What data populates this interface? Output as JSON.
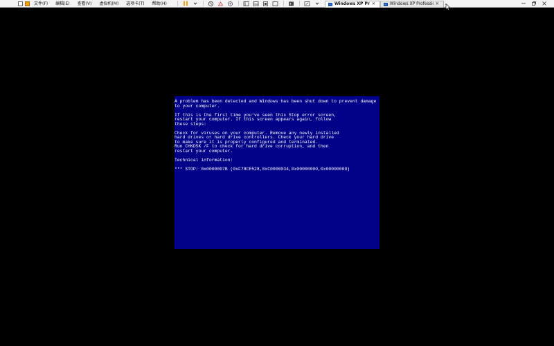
{
  "toolbar": {
    "menu": [
      {
        "label": "文件(F)"
      },
      {
        "label": "编辑(E)"
      },
      {
        "label": "查看(V)"
      },
      {
        "label": "虚拟机(M)"
      },
      {
        "label": "选项卡(T)"
      },
      {
        "label": "帮助(H)"
      }
    ],
    "tabs": [
      {
        "label": "Windows XP Professional ...",
        "active": true
      },
      {
        "label": "Windows XP Professional",
        "active": false
      }
    ],
    "colors": {
      "toolbar_bg": "#f3f3f3",
      "pause_icon": "#f2a30f"
    }
  },
  "bsod": {
    "background": "#000088",
    "text_color": "#ffffff",
    "lines": [
      "A problem has been detected and Windows has been shut down to prevent damage",
      "to your computer.",
      "",
      "If this is the first time you've seen this Stop error screen,",
      "restart your computer. If this screen appears again, follow",
      "these steps:",
      "",
      "Check for viruses on your computer. Remove any newly installed",
      "hard drives or hard drive controllers. Check your hard drive",
      "to make sure it is properly configured and terminated.",
      "Run CHKDSK /F to check for hard drive corruption, and then",
      "restart your computer.",
      "",
      "Technical information:",
      "",
      "*** STOP: 0x0000007B (0xF78CE528,0xC0000034,0x00000000,0x00000000)"
    ]
  }
}
